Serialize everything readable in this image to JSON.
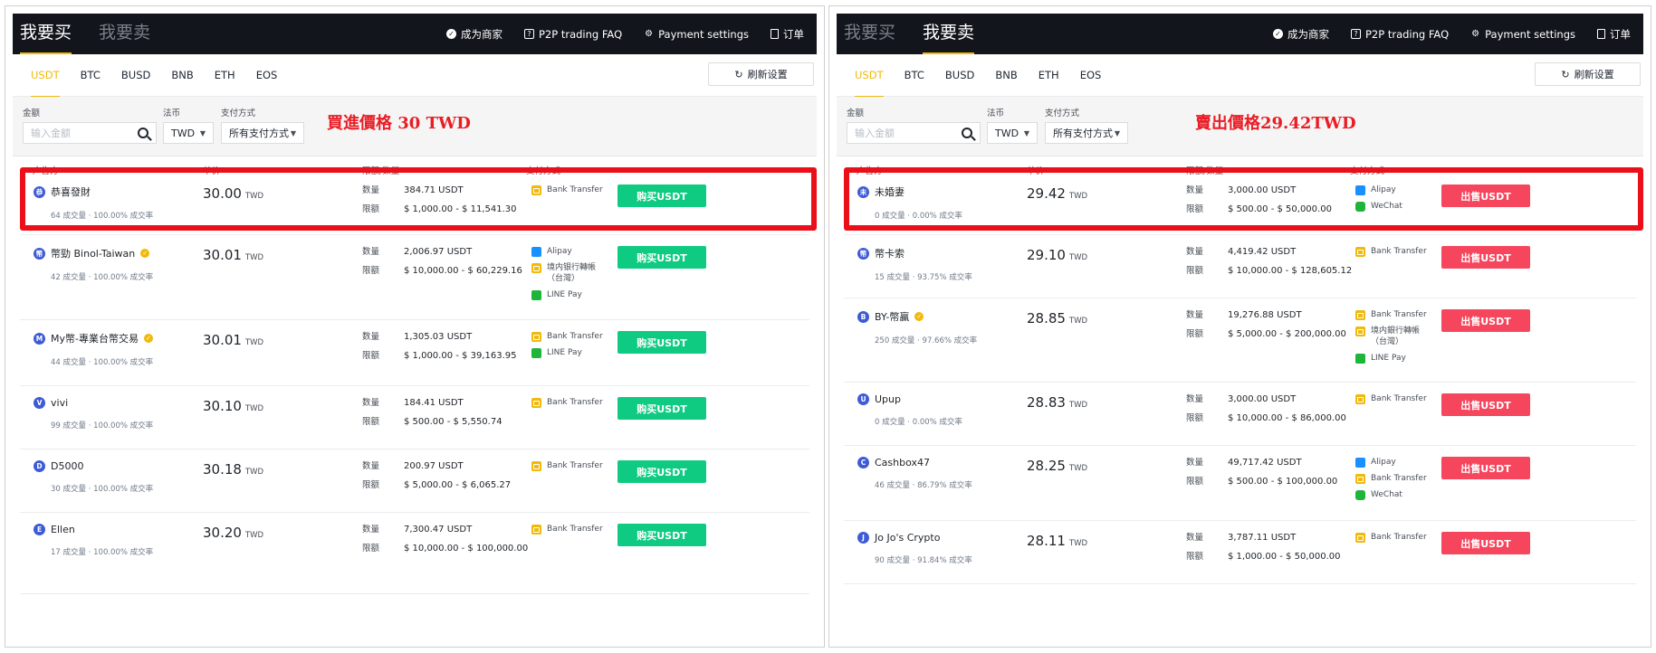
{
  "left": {
    "tabs": [
      "我要买",
      "我要卖"
    ],
    "active_tab": 0,
    "header_links": [
      "成为商家",
      "P2P trading FAQ",
      "Payment settings",
      "订单"
    ],
    "coins": [
      "USDT",
      "BTC",
      "BUSD",
      "BNB",
      "ETH",
      "EOS"
    ],
    "refresh": "刷新设置",
    "filters": {
      "amount_label": "金额",
      "amount_placeholder": "输入金额",
      "fiat_label": "法币",
      "fiat_value": "TWD",
      "payment_label": "支付方式",
      "payment_value": "所有支付方式"
    },
    "annotation": "買進價格 30 TWD",
    "columns": [
      "广告方",
      "单价",
      "限额/数量",
      "支付方式"
    ],
    "qty_key": "数量",
    "limit_key": "限额",
    "action": "购买USDT",
    "rows": [
      {
        "avatar": "恭",
        "name": "恭喜發財",
        "verified": false,
        "stats": "64 成交量 · 100.00% 成交率",
        "price": "30.00",
        "unit": "TWD",
        "qty": "384.71 USDT",
        "limit": "$ 1,000.00 - $ 11,541.30",
        "pays": [
          {
            "icon": "bank",
            "label": "Bank Transfer"
          }
        ]
      },
      {
        "avatar": "幣",
        "name": "幣勁 Binol-Taiwan",
        "verified": true,
        "stats": "42 成交量 · 100.00% 成交率",
        "price": "30.01",
        "unit": "TWD",
        "qty": "2,006.97 USDT",
        "limit": "$ 10,000.00 - $ 60,229.16",
        "pays": [
          {
            "icon": "ali",
            "label": "Alipay"
          },
          {
            "icon": "bank",
            "label": "境内银行轉帳\n（台灣）"
          },
          {
            "icon": "line",
            "label": "LINE Pay"
          }
        ]
      },
      {
        "avatar": "M",
        "name": "My幣-專業台幣交易",
        "verified": true,
        "stats": "44 成交量 · 100.00% 成交率",
        "price": "30.01",
        "unit": "TWD",
        "qty": "1,305.03 USDT",
        "limit": "$ 1,000.00 - $ 39,163.95",
        "pays": [
          {
            "icon": "bank",
            "label": "Bank Transfer"
          },
          {
            "icon": "line",
            "label": "LINE Pay"
          }
        ]
      },
      {
        "avatar": "V",
        "name": "vivi",
        "verified": false,
        "stats": "99 成交量 · 100.00% 成交率",
        "price": "30.10",
        "unit": "TWD",
        "qty": "184.41 USDT",
        "limit": "$ 500.00 - $ 5,550.74",
        "pays": [
          {
            "icon": "bank",
            "label": "Bank Transfer"
          }
        ]
      },
      {
        "avatar": "D",
        "name": "D5000",
        "verified": false,
        "stats": "30 成交量 · 100.00% 成交率",
        "price": "30.18",
        "unit": "TWD",
        "qty": "200.97 USDT",
        "limit": "$ 5,000.00 - $ 6,065.27",
        "pays": [
          {
            "icon": "bank",
            "label": "Bank Transfer"
          }
        ]
      },
      {
        "avatar": "E",
        "name": "Ellen",
        "verified": false,
        "stats": "17 成交量 · 100.00% 成交率",
        "price": "30.20",
        "unit": "TWD",
        "qty": "7,300.47 USDT",
        "limit": "$ 10,000.00 - $ 100,000.00",
        "pays": [
          {
            "icon": "bank",
            "label": "Bank Transfer"
          }
        ]
      }
    ]
  },
  "right": {
    "tabs": [
      "我要买",
      "我要卖"
    ],
    "active_tab": 1,
    "header_links": [
      "成为商家",
      "P2P trading FAQ",
      "Payment settings",
      "订单"
    ],
    "coins": [
      "USDT",
      "BTC",
      "BUSD",
      "BNB",
      "ETH",
      "EOS"
    ],
    "refresh": "刷新设置",
    "filters": {
      "amount_label": "金额",
      "amount_placeholder": "输入金额",
      "fiat_label": "法币",
      "fiat_value": "TWD",
      "payment_label": "支付方式",
      "payment_value": "所有支付方式"
    },
    "annotation": "賣出價格29.42TWD",
    "columns": [
      "广告方",
      "单价",
      "限额/数量",
      "支付方式"
    ],
    "qty_key": "数量",
    "limit_key": "限额",
    "action": "出售USDT",
    "rows": [
      {
        "avatar": "未",
        "name": "未婚妻",
        "verified": false,
        "stats": "0 成交量 · 0.00% 成交率",
        "price": "29.42",
        "unit": "TWD",
        "qty": "3,000.00 USDT",
        "limit": "$ 500.00 - $ 50,000.00",
        "pays": [
          {
            "icon": "ali",
            "label": "Alipay"
          },
          {
            "icon": "wechat",
            "label": "WeChat"
          }
        ]
      },
      {
        "avatar": "幣",
        "name": "幣卡索",
        "verified": false,
        "stats": "15 成交量 · 93.75% 成交率",
        "price": "29.10",
        "unit": "TWD",
        "qty": "4,419.42 USDT",
        "limit": "$ 10,000.00 - $ 128,605.12",
        "pays": [
          {
            "icon": "bank",
            "label": "Bank Transfer"
          }
        ]
      },
      {
        "avatar": "B",
        "name": "BY-幣贏",
        "verified": true,
        "stats": "250 成交量 · 97.66% 成交率",
        "price": "28.85",
        "unit": "TWD",
        "qty": "19,276.88 USDT",
        "limit": "$ 5,000.00 - $ 200,000.00",
        "pays": [
          {
            "icon": "bank",
            "label": "Bank Transfer"
          },
          {
            "icon": "bank",
            "label": "境内銀行轉帳\n（台灣）"
          },
          {
            "icon": "line",
            "label": "LINE Pay"
          }
        ]
      },
      {
        "avatar": "U",
        "name": "Upup",
        "verified": false,
        "stats": "0 成交量 · 0.00% 成交率",
        "price": "28.83",
        "unit": "TWD",
        "qty": "3,000.00 USDT",
        "limit": "$ 10,000.00 - $ 86,000.00",
        "pays": [
          {
            "icon": "bank",
            "label": "Bank Transfer"
          }
        ]
      },
      {
        "avatar": "C",
        "name": "Cashbox47",
        "verified": false,
        "stats": "46 成交量 · 86.79% 成交率",
        "price": "28.25",
        "unit": "TWD",
        "qty": "49,717.42 USDT",
        "limit": "$ 500.00 - $ 100,000.00",
        "pays": [
          {
            "icon": "ali",
            "label": "Alipay"
          },
          {
            "icon": "bank",
            "label": "Bank Transfer"
          },
          {
            "icon": "wechat",
            "label": "WeChat"
          }
        ]
      },
      {
        "avatar": "J",
        "name": "Jo Jo's Crypto",
        "verified": false,
        "stats": "90 成交量 · 91.84% 成交率",
        "price": "28.11",
        "unit": "TWD",
        "qty": "3,787.11 USDT",
        "limit": "$ 1,000.00 - $ 50,000.00",
        "pays": [
          {
            "icon": "bank",
            "label": "Bank Transfer"
          }
        ]
      }
    ]
  }
}
